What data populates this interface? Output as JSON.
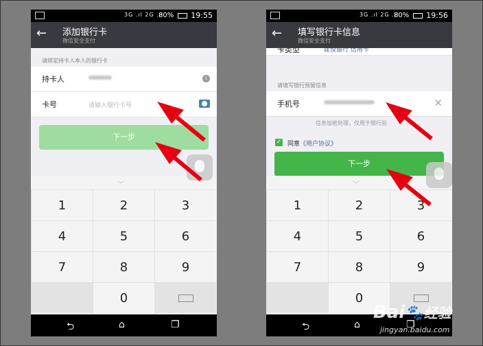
{
  "left": {
    "status_time": "19:55",
    "status_battery": "80%",
    "status_signal": "3G .ıl 2G .ıl",
    "title": "添加银行卡",
    "subtitle": "微信安全支付",
    "hint": "请绑定持卡人本人的银行卡",
    "cardholder_label": "持卡人",
    "cardnumber_label": "卡号",
    "cardnumber_placeholder": "请输入银行卡号",
    "next_label": "下一步"
  },
  "right": {
    "status_time": "19:56",
    "status_battery": "80%",
    "status_signal": "3G .ıl 2G .ıl",
    "title": "填写银行卡信息",
    "subtitle": "微信安全支付",
    "card_type_label": "卡类型",
    "card_type_value": "建设银行 信用卡",
    "hint": "请填写银行预留信息",
    "phone_label": "手机号",
    "encrypt_note": "信息加密处理，仅用于银行验",
    "agree_label": "同意",
    "agreement_link": "《用户协议》",
    "next_label": "下一步"
  },
  "keys": [
    "1",
    "2",
    "3",
    "4",
    "5",
    "6",
    "7",
    "8",
    "9",
    "0"
  ],
  "icons": [
    "back-arrow-icon",
    "info-icon",
    "camera-icon",
    "clear-icon",
    "checkbox-icon",
    "backspace-icon",
    "chevron-down-icon",
    "nav-back-icon",
    "nav-home-icon",
    "nav-recents-icon",
    "bulb-icon",
    "annotation-arrow"
  ],
  "colors": {
    "green": "#44b549",
    "green_disabled": "#9fdc9f",
    "titlebar": "#393a3f",
    "arrow": "#e60012"
  },
  "watermark": {
    "brand_left": "Bai",
    "brand_right": "经验",
    "url": "jingyan.baidu.com"
  }
}
